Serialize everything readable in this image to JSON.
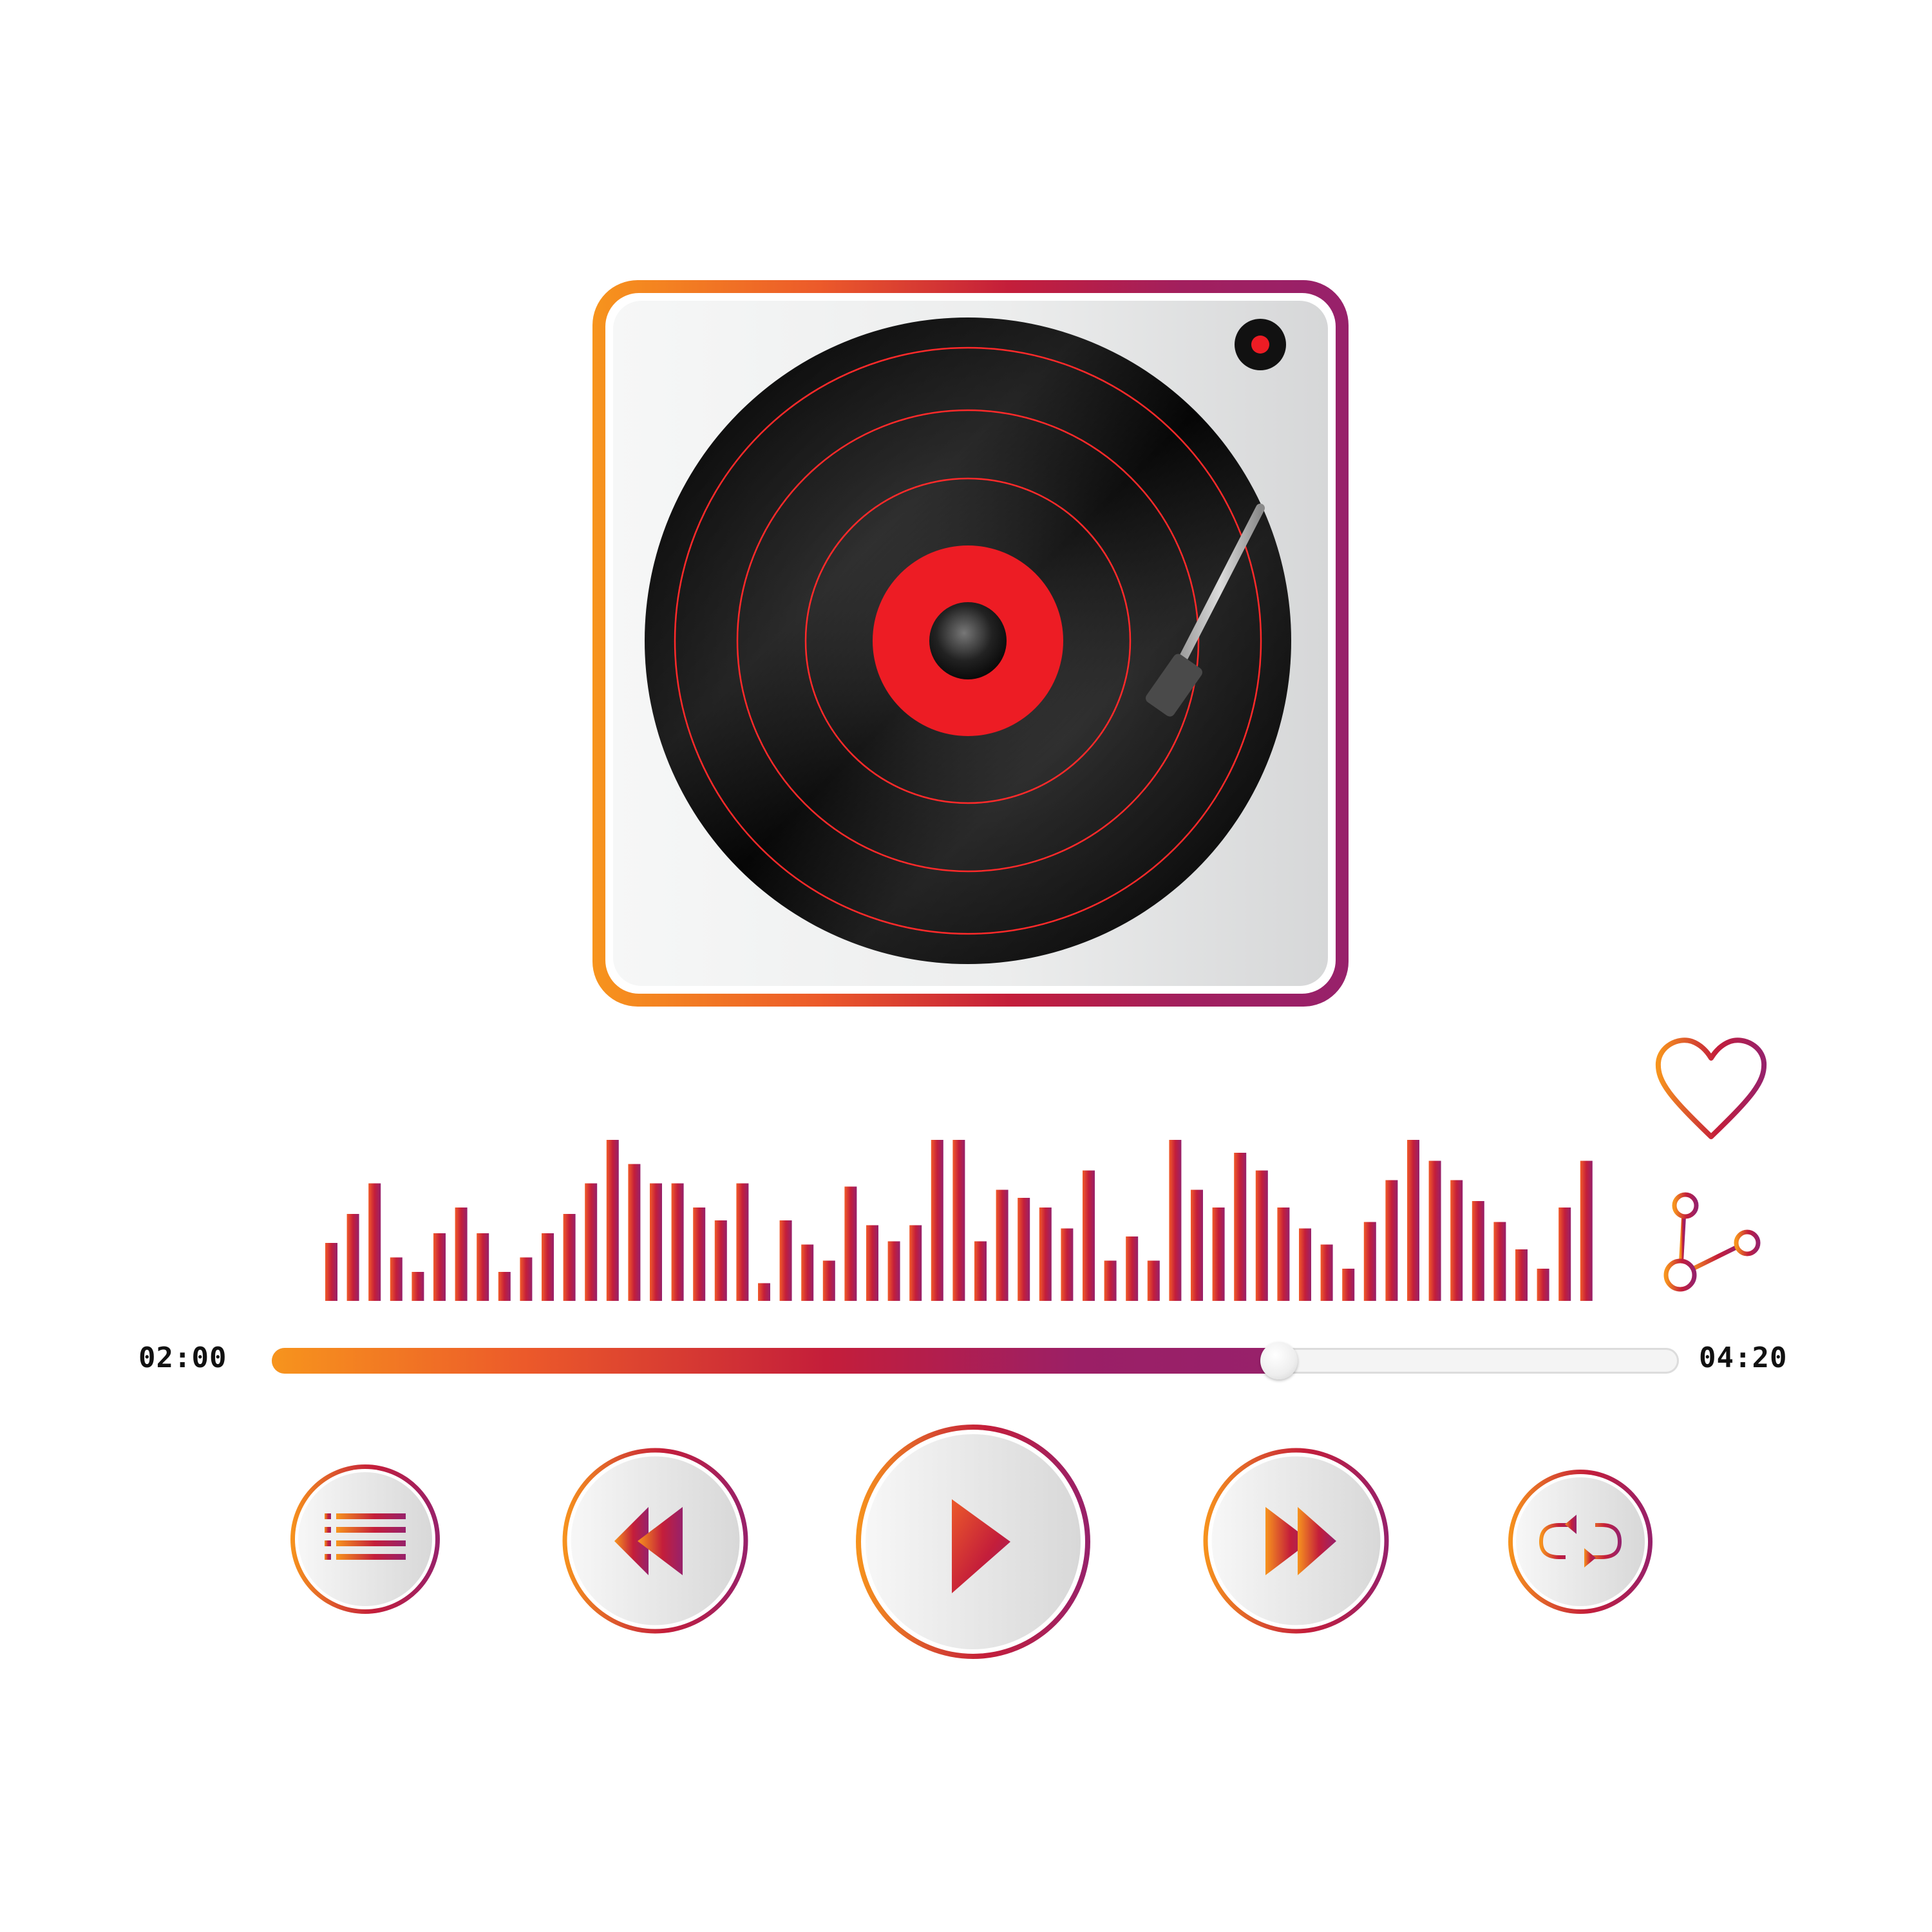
{
  "colors": {
    "gradient_start": "#f7941d",
    "gradient_mid": "#c41e3a",
    "gradient_end": "#97216b",
    "record_black": "#0a0a0a",
    "label_red": "#ed1c24",
    "groove_red": "#ff2a2a",
    "button_face": "#eeeeee"
  },
  "turntable": {
    "record": "vinyl-record",
    "tonearm": "tonearm"
  },
  "equalizer": {
    "levels": [
      0.36,
      0.54,
      0.73,
      0.27,
      0.18,
      0.42,
      0.58,
      0.42,
      0.18,
      0.27,
      0.42,
      0.54,
      0.73,
      1.0,
      0.85,
      0.73,
      0.73,
      0.58,
      0.5,
      0.73,
      0.11,
      0.5,
      0.35,
      0.25,
      0.71,
      0.47,
      0.37,
      0.47,
      1.0,
      1.0,
      0.37,
      0.69,
      0.64,
      0.58,
      0.45,
      0.81,
      0.25,
      0.4,
      0.25,
      1.0,
      0.69,
      0.58,
      0.92,
      0.81,
      0.58,
      0.45,
      0.35,
      0.2,
      0.49,
      0.75,
      1.0,
      0.87,
      0.75,
      0.62,
      0.49,
      0.32,
      0.2,
      0.58,
      0.87
    ]
  },
  "actions": {
    "favorite_icon": "heart-icon",
    "share_icon": "share-icon"
  },
  "player": {
    "elapsed": "02:00",
    "total": "04:20",
    "progress_fraction": 0.716
  },
  "controls": {
    "playlist_icon": "list-icon",
    "rewind_icon": "rewind-icon",
    "play_icon": "play-icon",
    "forward_icon": "fast-forward-icon",
    "repeat_icon": "repeat-icon"
  }
}
